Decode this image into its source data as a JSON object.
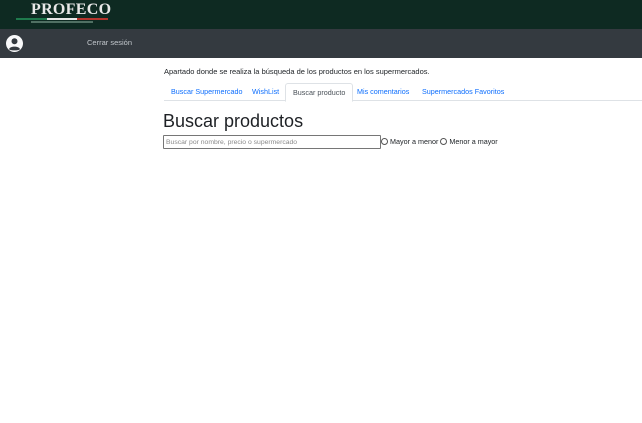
{
  "brand": {
    "logo_text": "PROFECO",
    "colors": {
      "topbar": "#0e2a22",
      "stripe_green": "#1f7a4d",
      "stripe_white": "#e8e8e8",
      "stripe_red": "#b5352d"
    }
  },
  "user": {
    "avatar_icon": "user-circle-icon",
    "name": "",
    "logout_label": "Cerrar sesión"
  },
  "main": {
    "description": "Apartado donde se realiza la búsqueda de los productos en los supermercados.",
    "tabs": [
      {
        "label": "Buscar Supermercado",
        "active": false
      },
      {
        "label": "WishList",
        "active": false
      },
      {
        "label": "Buscar producto",
        "active": true
      },
      {
        "label": "Mis comentarios",
        "active": false
      },
      {
        "label": "Supermercados Favoritos",
        "active": false
      }
    ],
    "heading": "Buscar productos",
    "search": {
      "placeholder": "Buscar por nombre, precio o supermercado",
      "value": ""
    },
    "sort_options": [
      {
        "label": "Mayor a menor",
        "checked": false
      },
      {
        "label": "Menor a mayor",
        "checked": false
      }
    ]
  }
}
